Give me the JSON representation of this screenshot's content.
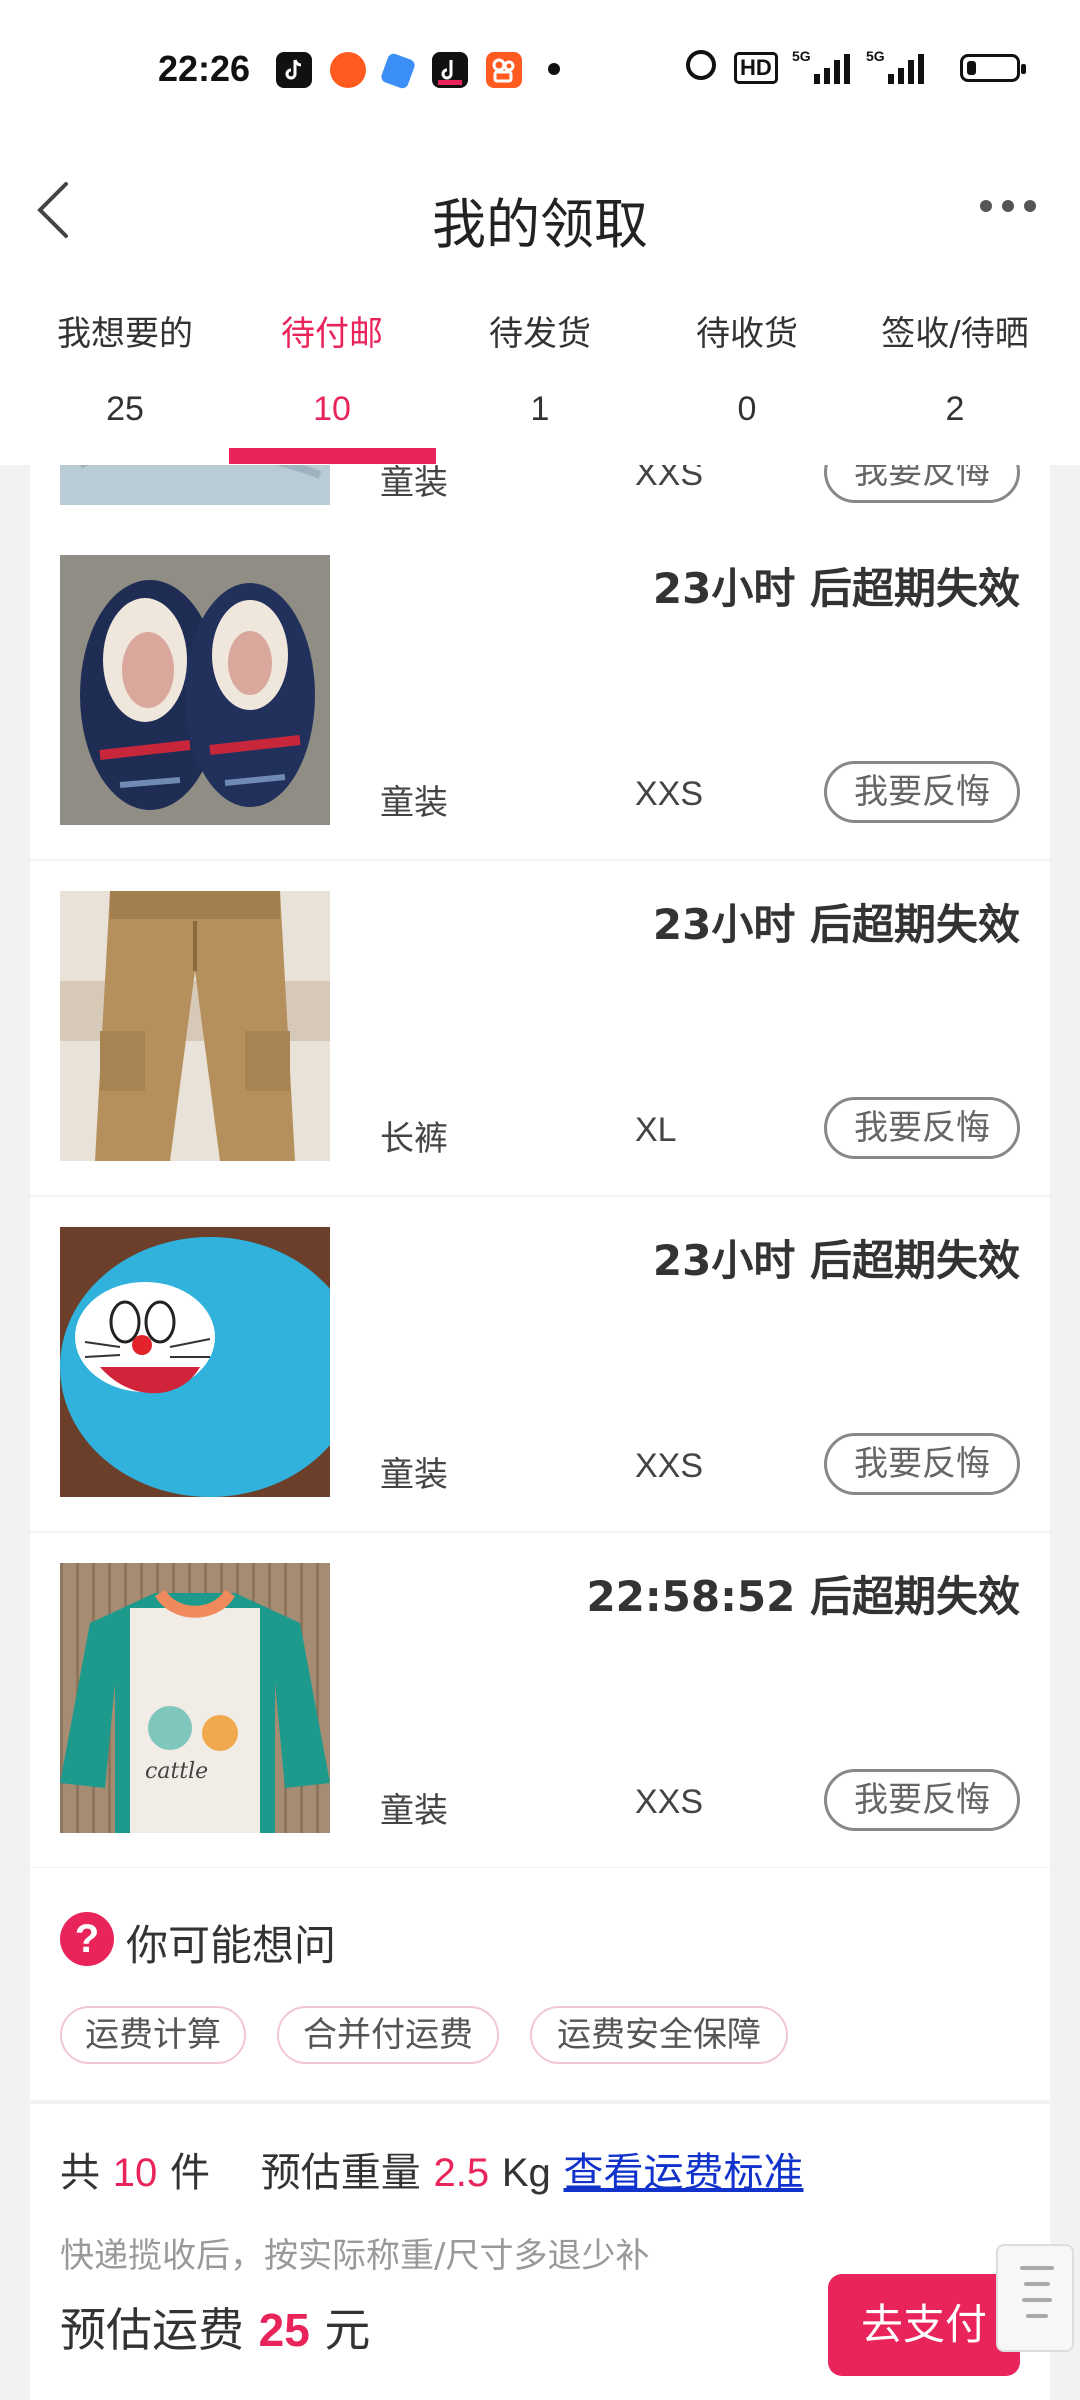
{
  "status_bar": {
    "time": "22:26",
    "network": [
      "5G",
      "5G"
    ],
    "hd_label": "HD",
    "battery_level": 0.18,
    "notification_apps": [
      "douyin-icon",
      "weibo-icon",
      "app-icon",
      "douyin-lite-icon",
      "kuaishou-icon"
    ]
  },
  "header": {
    "title": "我的领取"
  },
  "tabs": [
    {
      "label": "我想要的",
      "count": "25",
      "active": false
    },
    {
      "label": "待付邮",
      "count": "10",
      "active": true
    },
    {
      "label": "待发货",
      "count": "1",
      "active": false
    },
    {
      "label": "待收货",
      "count": "0",
      "active": false
    },
    {
      "label": "签收/待晒",
      "count": "2",
      "active": false
    }
  ],
  "items": [
    {
      "countdown": "",
      "category": "童装",
      "size": "XXS",
      "button": "我要反悔",
      "image": "light-blue-garment-photo"
    },
    {
      "countdown": "23小时 后超期失效",
      "category": "童装",
      "size": "XXS",
      "button": "我要反悔",
      "image": "navy-kids-sneakers-photo"
    },
    {
      "countdown": "23小时 后超期失效",
      "category": "长裤",
      "size": "XL",
      "button": "我要反悔",
      "image": "khaki-cargo-pants-photo"
    },
    {
      "countdown": "23小时 后超期失效",
      "category": "童装",
      "size": "XXS",
      "button": "我要反悔",
      "image": "doraemon-plush-hat-photo"
    },
    {
      "countdown": "22:58:52 后超期失效",
      "category": "童装",
      "size": "XXS",
      "button": "我要反悔",
      "image": "cattle-kids-sweater-photo"
    }
  ],
  "faq": {
    "title": "你可能想问",
    "icon": "question-icon",
    "chips": [
      "运费计算",
      "合并付运费",
      "运费安全保障"
    ]
  },
  "summary": {
    "prefix": "共",
    "count": "10",
    "count_unit": "件",
    "weight_label": "预估重量",
    "weight": "2.5",
    "weight_unit": "Kg",
    "standard_link": "查看运费标准",
    "note": "快递揽收后，按实际称重/尺寸多退少补",
    "fee_label": "预估运费",
    "fee": "25",
    "fee_unit": "元",
    "pay_button": "去支付"
  },
  "colors": {
    "accent": "#e8245a",
    "link": "#1133cc",
    "page_bg": "#f2f2f2"
  }
}
